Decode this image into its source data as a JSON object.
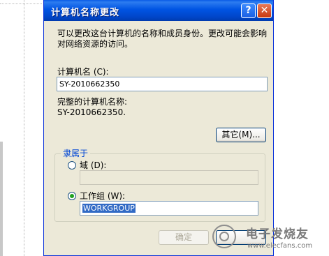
{
  "dialog": {
    "title": "计算机名称更改",
    "description": "可以更改这台计算机的名称和成员身份。更改可能会影响对网络资源的访问。",
    "computer_name_label": "计算机名 (C):",
    "computer_name_value": "SY-2010662350",
    "full_name_label": "完整的计算机名称:",
    "full_name_value": "SY-2010662350.",
    "other_button": "其它(M)...",
    "member_group_title": "隶属于",
    "domain_label": "域 (D):",
    "domain_value": "",
    "workgroup_label": "工作组 (W):",
    "workgroup_value": "WORKGROUP",
    "ok_button": "确定",
    "help_glyph": "?",
    "close_glyph": "✕"
  },
  "watermark": {
    "text": "电子发烧友",
    "url": "www.elecfans.com"
  },
  "colors": {
    "titlebar": "#0054e3",
    "dialog_bg": "#ece9d8",
    "group_title": "#0046d5",
    "selection": "#316ac5",
    "radio_dot": "#21a121"
  }
}
